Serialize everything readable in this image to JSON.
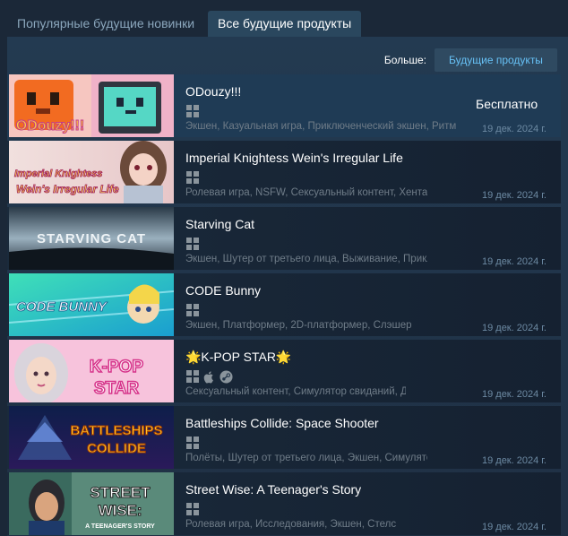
{
  "tabs": [
    {
      "label": "Популярные будущие новинки"
    },
    {
      "label": "Все будущие продукты"
    }
  ],
  "more": {
    "label": "Больше:",
    "button": "Будущие продукты"
  },
  "items": [
    {
      "title": "ODouzy!!!",
      "tags": "Экшен, Казуальная игра, Приключенческий экшен, Ритм",
      "date": "19 дек. 2024 г.",
      "price": "Бесплатно",
      "capsule_text": "ODouzy!!!",
      "platforms": [
        "windows"
      ]
    },
    {
      "title": "Imperial Knightess Wein's Irregular Life",
      "tags": "Ролевая игра, NSFW, Сексуальный контент, Хентай",
      "date": "19 дек. 2024 г.",
      "capsule_text": "Imperial Knightess Wein's Irregular Life",
      "platforms": [
        "windows"
      ]
    },
    {
      "title": "Starving Cat",
      "tags": "Экшен, Шутер от третьего лица, Выживание, Приключения",
      "date": "19 дек. 2024 г.",
      "capsule_text": "STARVING CAT",
      "platforms": [
        "windows"
      ]
    },
    {
      "title": "CODE Bunny",
      "tags": "Экшен, Платформер, 2D-платформер, Слэшер",
      "date": "19 дек. 2024 г.",
      "capsule_text": "CODE BUNNY",
      "platforms": [
        "windows"
      ]
    },
    {
      "title": "🌟K-POP STAR🌟",
      "tags": "Сексуальный контент, Симулятор свиданий, Для взрослых",
      "date": "19 дек. 2024 г.",
      "capsule_text": "K-POP STAR",
      "platforms": [
        "windows",
        "mac",
        "steam"
      ]
    },
    {
      "title": "Battleships Collide: Space Shooter",
      "tags": "Полёты, Шутер от третьего лица, Экшен, Симулятор",
      "date": "19 дек. 2024 г.",
      "capsule_text": "BATTLESHIPS COLLIDE",
      "platforms": [
        "windows"
      ]
    },
    {
      "title": "Street Wise: A Teenager's Story",
      "tags": "Ролевая игра, Исследования, Экшен, Стелс",
      "date": "19 дек. 2024 г.",
      "capsule_text": "STREET WISE: A TEENAGER'S STORY",
      "platforms": [
        "windows"
      ]
    }
  ],
  "colors": {
    "background": "#1b2838",
    "accent": "#67c1f5",
    "tab_active": "#2a475e"
  }
}
